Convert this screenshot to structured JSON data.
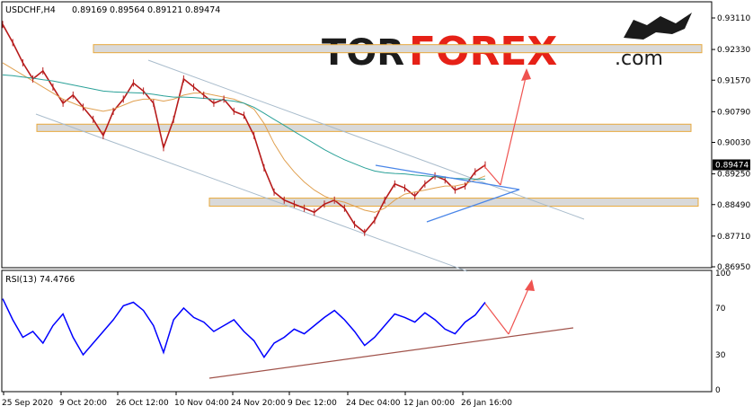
{
  "chart_data": [
    {
      "type": "line",
      "panel": "price",
      "header": {
        "symbol": "USDCHF,H4",
        "open": "0.89169",
        "high": "0.89564",
        "low": "0.89121",
        "close": "0.89474"
      },
      "current_price": {
        "value": 0.89474,
        "label": "0.89474"
      },
      "y_ticks": [
        "0.93110",
        "0.92330",
        "0.91570",
        "0.90790",
        "0.90030",
        "0.89250",
        "0.88490",
        "0.87710",
        "0.86950"
      ],
      "ylim": [
        0.8695,
        0.9311
      ],
      "x_ticks": [
        "25 Sep 2020",
        "9 Oct 20:00",
        "26 Oct 12:00",
        "10 Nov 04:00",
        "24 Nov 20:00",
        "9 Dec 12:00",
        "24 Dec 04:00",
        "12 Jan 00:00",
        "26 Jan 16:00"
      ],
      "series": [
        {
          "kind": "price",
          "color": "#b71c1c",
          "values": [
            0.9295,
            0.925,
            0.92,
            0.916,
            0.918,
            0.914,
            0.91,
            0.912,
            0.909,
            0.906,
            0.902,
            0.908,
            0.911,
            0.915,
            0.913,
            0.91,
            0.899,
            0.906,
            0.916,
            0.914,
            0.912,
            0.91,
            0.911,
            0.908,
            0.907,
            0.902,
            0.894,
            0.888,
            0.886,
            0.885,
            0.884,
            0.883,
            0.885,
            0.886,
            0.884,
            0.88,
            0.878,
            0.881,
            0.886,
            0.89,
            0.889,
            0.887,
            0.89,
            0.892,
            0.891,
            0.8885,
            0.8895,
            0.893,
            0.8947
          ]
        },
        {
          "kind": "moving-average",
          "color": "#e0a050",
          "values": [
            0.92,
            0.9185,
            0.917,
            0.9155,
            0.914,
            0.9125,
            0.911,
            0.91,
            0.909,
            0.9085,
            0.908,
            0.9085,
            0.9095,
            0.9105,
            0.911,
            0.911,
            0.9105,
            0.911,
            0.912,
            0.9125,
            0.9125,
            0.912,
            0.9115,
            0.911,
            0.91,
            0.9085,
            0.905,
            0.9,
            0.896,
            0.893,
            0.8905,
            0.8885,
            0.887,
            0.886,
            0.8855,
            0.8845,
            0.8835,
            0.883,
            0.884,
            0.886,
            0.8875,
            0.888,
            0.8885,
            0.889,
            0.8895,
            0.8895,
            0.89,
            0.891,
            0.892
          ]
        },
        {
          "kind": "moving-average",
          "color": "#2aa198",
          "values": [
            0.917,
            0.9168,
            0.9165,
            0.9162,
            0.9158,
            0.9155,
            0.915,
            0.9145,
            0.914,
            0.9135,
            0.913,
            0.9128,
            0.9127,
            0.9126,
            0.9125,
            0.9122,
            0.9118,
            0.9115,
            0.9115,
            0.9114,
            0.9112,
            0.911,
            0.9108,
            0.9105,
            0.91,
            0.909,
            0.9075,
            0.906,
            0.9045,
            0.903,
            0.9015,
            0.9,
            0.8985,
            0.8972,
            0.896,
            0.895,
            0.894,
            0.8932,
            0.8928,
            0.8926,
            0.8925,
            0.8922,
            0.892,
            0.8918,
            0.8916,
            0.8914,
            0.8913,
            0.8912,
            0.8912
          ]
        }
      ],
      "zones": [
        [
          0.9225,
          0.9245
        ],
        [
          0.903,
          0.9048
        ],
        [
          0.8845,
          0.8865
        ]
      ],
      "annotations": [
        "descending channel",
        "triangle",
        "upside target arrow"
      ]
    },
    {
      "type": "line",
      "panel": "indicator",
      "label": "RSI(13) 74.4766",
      "y_ticks": [
        "100",
        "70",
        "30",
        "0"
      ],
      "ylim": [
        0,
        100
      ],
      "series": [
        {
          "kind": "rsi",
          "color": "#0000ff",
          "values": [
            78,
            60,
            45,
            50,
            40,
            55,
            65,
            45,
            30,
            40,
            50,
            60,
            72,
            75,
            68,
            55,
            32,
            60,
            70,
            62,
            58,
            50,
            55,
            60,
            50,
            42,
            28,
            40,
            45,
            52,
            48,
            55,
            62,
            68,
            60,
            50,
            38,
            45,
            55,
            65,
            62,
            58,
            66,
            60,
            52,
            48,
            58,
            64,
            75
          ]
        }
      ],
      "annotations": [
        "rising support line",
        "upside target arrow"
      ]
    }
  ],
  "brand": {
    "part1": "TOR",
    "part2": "FOREX",
    "part3": ".com"
  }
}
